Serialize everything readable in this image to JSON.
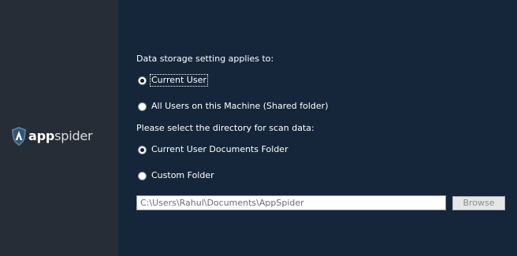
{
  "brand": {
    "name_bold": "app",
    "name_light": "spider",
    "logo_icon": "shield-icon"
  },
  "storage": {
    "heading": "Data storage setting applies to:",
    "options": [
      {
        "label": "Current User",
        "selected": true
      },
      {
        "label": "All Users on this Machine (Shared folder)",
        "selected": false
      }
    ]
  },
  "directory": {
    "heading": "Please select the directory for scan data:",
    "options": [
      {
        "label": "Current User Documents Folder",
        "selected": true
      },
      {
        "label": "Custom Folder",
        "selected": false
      }
    ],
    "path_value": "C:\\Users\\Rahul\\Documents\\AppSpider",
    "browse_label": "Browse"
  },
  "colors": {
    "sidebar": "#262d36",
    "content": "#15263a"
  }
}
